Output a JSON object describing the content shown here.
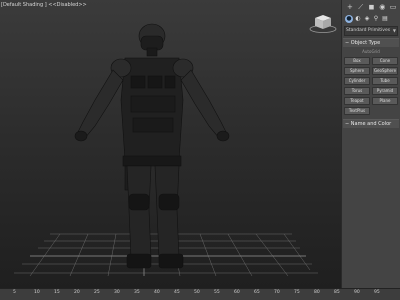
{
  "viewport": {
    "label": "[Default Shading ] <<Disabled>>"
  },
  "panel": {
    "tabs": [
      "+",
      "⟋",
      "◼",
      "◉",
      "▭",
      "⚒"
    ],
    "category_icons": [
      "●",
      "◐",
      "◈",
      "⚲",
      "▤",
      "✦",
      "◍"
    ],
    "dropdown": "Standard Primitives",
    "object_type": {
      "header": "Object Type",
      "autogrid": "AutoGrid",
      "buttons": [
        "Box",
        "Cone",
        "Sphere",
        "GeoSphere",
        "Cylinder",
        "Tube",
        "Torus",
        "Pyramid",
        "Teapot",
        "Plane",
        "TextPlus"
      ]
    },
    "name_color": {
      "header": "Name and Color"
    }
  },
  "timeline": {
    "ticks": [
      "5",
      "10",
      "15",
      "20",
      "25",
      "30",
      "35",
      "40",
      "45",
      "50",
      "55",
      "60",
      "65",
      "70",
      "75",
      "80",
      "85",
      "90",
      "95"
    ]
  }
}
